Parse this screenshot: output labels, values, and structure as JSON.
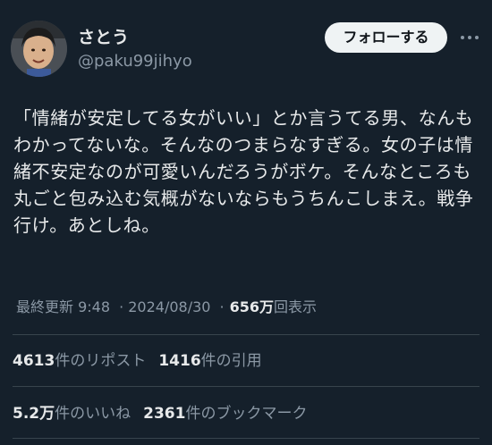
{
  "profile": {
    "display_name": "さとう",
    "handle": "@paku99jihyo"
  },
  "actions": {
    "follow_label": "フォローする",
    "more_icon": "more-horizontal-icon"
  },
  "tweet": {
    "text": "「情緒が安定してる女がいい」とか言うてる男、なんもわかってないな。そんなのつまらなすぎる。女の子は情緒不安定なのが可愛いんだろうがボケ。そんなところも丸ごと包み込む気概がないならもうちんこしまえ。戦争行け。あとしね。"
  },
  "meta": {
    "updated_label": "最終更新",
    "time": "9:48",
    "separator": "·",
    "date": "2024/08/30",
    "views_count": "656万",
    "views_label": "回表示"
  },
  "stats": {
    "reposts_count": "4613",
    "reposts_label": "件のリポスト",
    "quotes_count": "1416",
    "quotes_label": "件の引用",
    "likes_count": "5.2万",
    "likes_label": "件のいいね",
    "bookmarks_count": "2361",
    "bookmarks_label": "件のブックマーク"
  },
  "colors": {
    "background": "#15202b",
    "text_primary": "#e7e9ea",
    "text_secondary": "#8b98a5",
    "button_bg": "#eff3f4",
    "divider": "#38444d"
  }
}
